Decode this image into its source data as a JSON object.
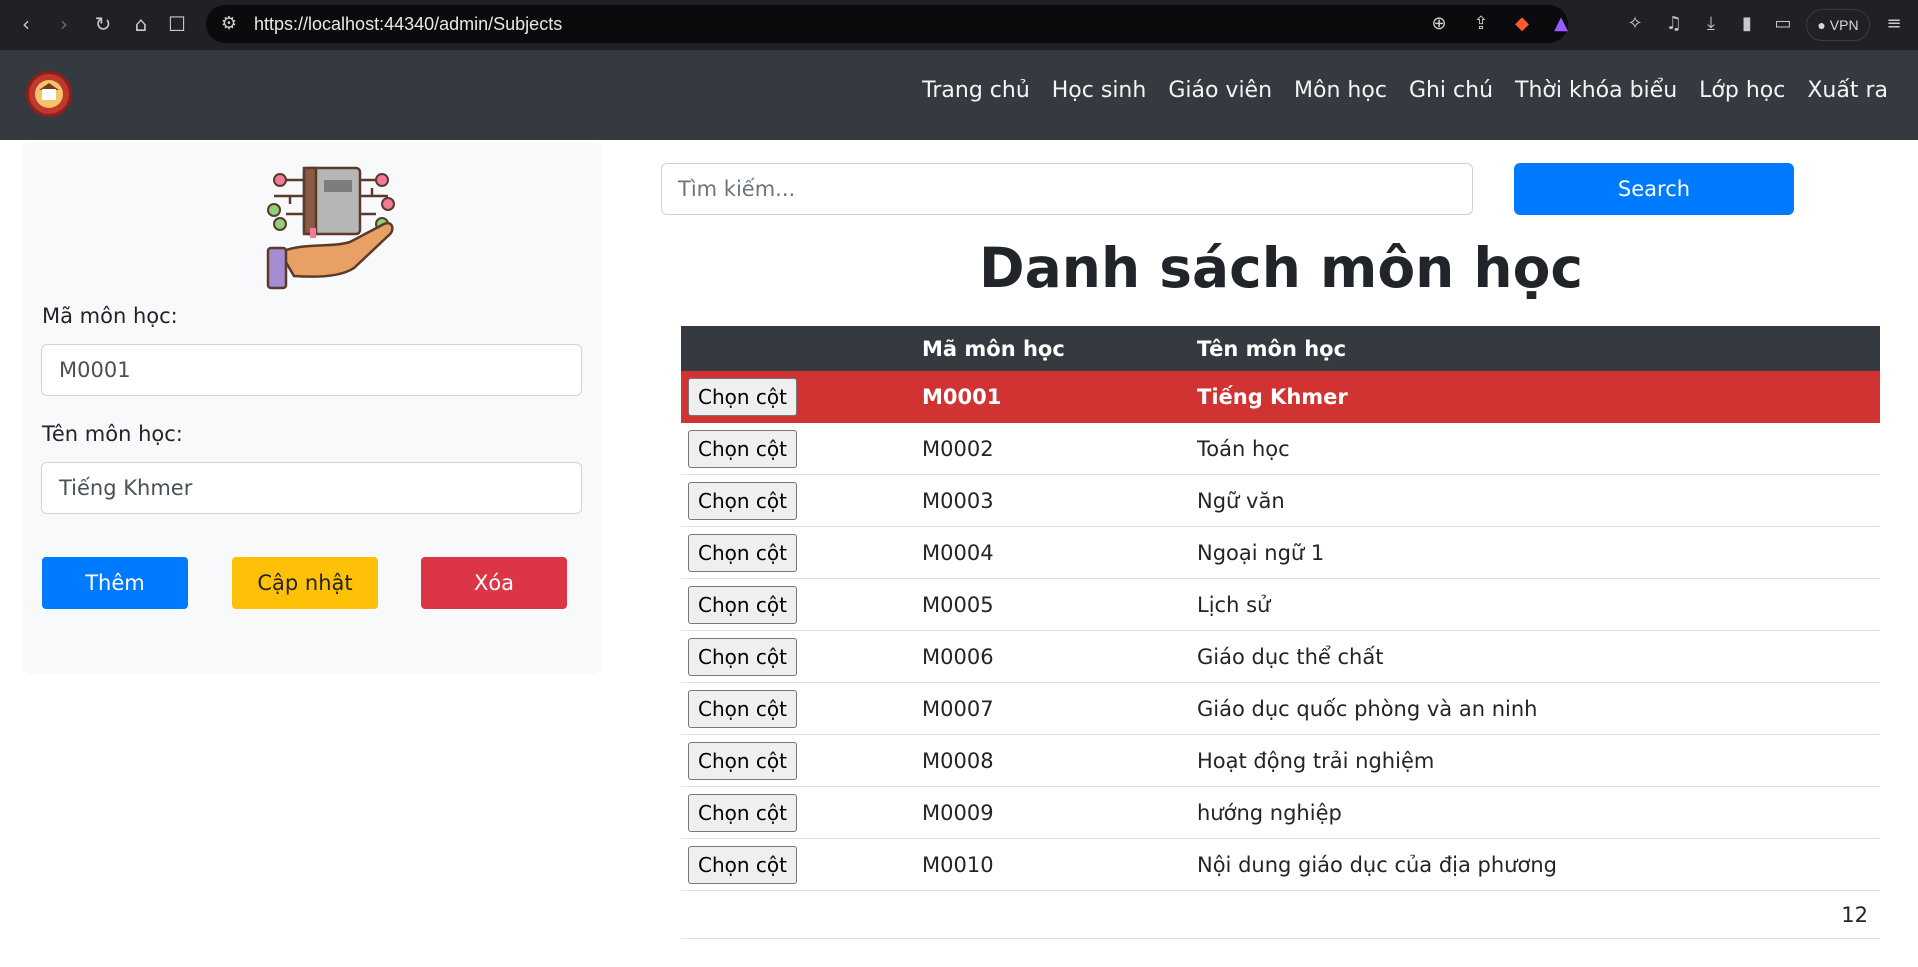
{
  "browser": {
    "url": "https://localhost:44340/admin/Subjects",
    "vpn_label": "VPN"
  },
  "nav": {
    "links": [
      "Trang chủ",
      "Học sinh",
      "Giáo viên",
      "Môn học",
      "Ghi chú",
      "Thời khóa biểu",
      "Lớp học",
      "Xuất ra"
    ]
  },
  "form": {
    "code_label": "Mã môn học:",
    "code_value": "M0001",
    "name_label": "Tên môn học:",
    "name_value": "Tiếng Khmer",
    "add_label": "Thêm",
    "update_label": "Cập nhật",
    "delete_label": "Xóa"
  },
  "search": {
    "placeholder": "Tìm kiếm...",
    "button_label": "Search"
  },
  "title": "Danh sách môn học",
  "table": {
    "headers": [
      "",
      "Mã môn học",
      "Tên môn học"
    ],
    "select_label": "Chọn cột",
    "rows": [
      {
        "code": "M0001",
        "name": "Tiếng Khmer",
        "selected": true
      },
      {
        "code": "M0002",
        "name": "Toán học"
      },
      {
        "code": "M0003",
        "name": "Ngữ văn"
      },
      {
        "code": "M0004",
        "name": "Ngoại ngữ 1"
      },
      {
        "code": "M0005",
        "name": "Lịch sử"
      },
      {
        "code": "M0006",
        "name": "Giáo dục thể chất"
      },
      {
        "code": "M0007",
        "name": "Giáo dục quốc phòng và an ninh"
      },
      {
        "code": "M0008",
        "name": "Hoạt động trải nghiệm"
      },
      {
        "code": "M0009",
        "name": "hướng nghiệp"
      },
      {
        "code": "M0010",
        "name": "Nội dung giáo dục của địa phương"
      }
    ],
    "pager": "12"
  },
  "colors": {
    "navbar": "#343a40",
    "selected_row": "#d13333",
    "primary": "#007bff",
    "warning": "#ffc107",
    "danger": "#dc3545"
  }
}
